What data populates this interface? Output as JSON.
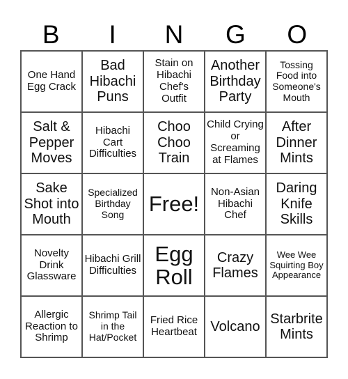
{
  "card": {
    "header_letters": [
      "B",
      "I",
      "N",
      "G",
      "O"
    ],
    "cells": [
      {
        "text": "One Hand Egg Crack",
        "size": "m"
      },
      {
        "text": "Bad Hibachi Puns",
        "size": "l"
      },
      {
        "text": "Stain on Hibachi Chef's Outfit",
        "size": "m"
      },
      {
        "text": "Another Birthday Party",
        "size": "l"
      },
      {
        "text": "Tossing Food into Someone's Mouth",
        "size": "s"
      },
      {
        "text": "Salt & Pepper Moves",
        "size": "l"
      },
      {
        "text": "Hibachi Cart Difficulties",
        "size": "m"
      },
      {
        "text": "Choo Choo Train",
        "size": "l"
      },
      {
        "text": "Child Crying or Screaming at Flames",
        "size": "m"
      },
      {
        "text": "After Dinner Mints",
        "size": "l"
      },
      {
        "text": "Sake Shot into Mouth",
        "size": "l"
      },
      {
        "text": "Specialized Birthday Song",
        "size": "s"
      },
      {
        "text": "Free!",
        "size": "xl"
      },
      {
        "text": "Non-Asian Hibachi Chef",
        "size": "m"
      },
      {
        "text": "Daring Knife Skills",
        "size": "l"
      },
      {
        "text": "Novelty Drink Glassware",
        "size": "m"
      },
      {
        "text": "Hibachi Grill Difficulties",
        "size": "m"
      },
      {
        "text": "Egg Roll",
        "size": "xl"
      },
      {
        "text": "Crazy Flames",
        "size": "l"
      },
      {
        "text": "Wee Wee Squirting Boy Appearance",
        "size": "xs"
      },
      {
        "text": "Allergic Reaction to Shrimp",
        "size": "m"
      },
      {
        "text": "Shrimp Tail in the Hat/Pocket",
        "size": "s"
      },
      {
        "text": "Fried Rice Heartbeat",
        "size": "m"
      },
      {
        "text": "Volcano",
        "size": "l"
      },
      {
        "text": "Starbrite Mints",
        "size": "l"
      }
    ]
  }
}
